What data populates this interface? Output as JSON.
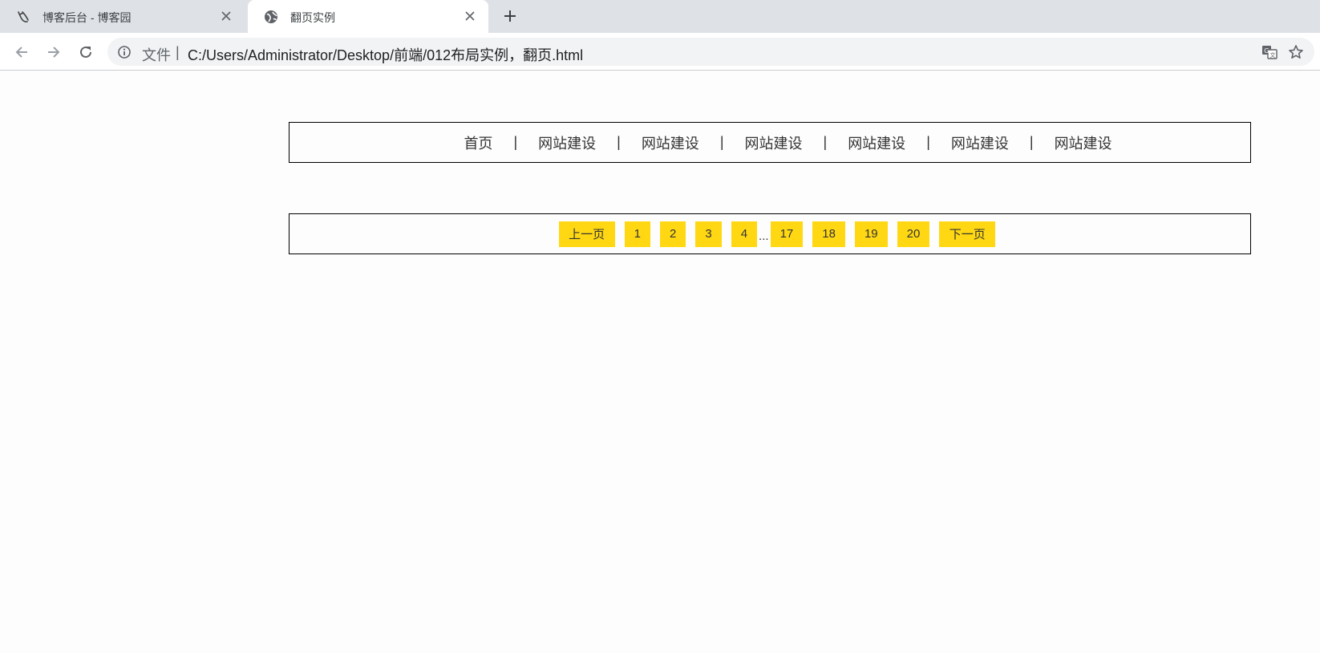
{
  "browser": {
    "tabs": [
      {
        "title": "博客后台 - 博客园",
        "icon": "cnblogs-logo-icon",
        "active": false
      },
      {
        "title": "翻页实例",
        "icon": "globe-icon",
        "active": true
      }
    ],
    "address_bar": {
      "scheme_label": "文件",
      "divider": "|",
      "url": "C:/Users/Administrator/Desktop/前端/012布局实例，翻页.html"
    }
  },
  "nav_menu": {
    "items": [
      "首页",
      "网站建设",
      "网站建设",
      "网站建设",
      "网站建设",
      "网站建设",
      "网站建设"
    ],
    "separator": "|"
  },
  "pagination": {
    "prev_label": "上一页",
    "pages_before": [
      "1",
      "2",
      "3",
      "4"
    ],
    "ellipsis": "...",
    "pages_after": [
      "17",
      "18",
      "19",
      "20"
    ],
    "next_label": "下一页",
    "button_color": "#ffd813"
  }
}
